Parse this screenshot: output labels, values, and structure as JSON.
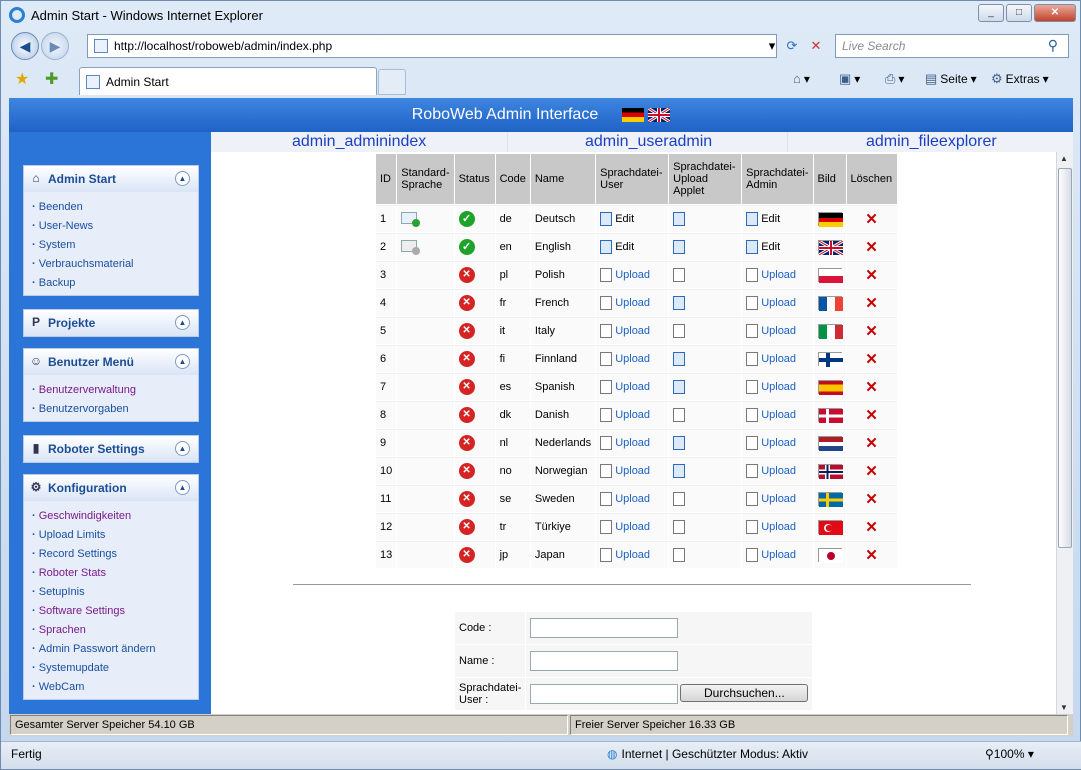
{
  "window": {
    "title": "Admin Start - Windows Internet Explorer"
  },
  "address": {
    "url": "http://localhost/roboweb/admin/index.php",
    "search_placeholder": "Live Search"
  },
  "tab": {
    "label": "Admin Start"
  },
  "commands": {
    "page": "Seite",
    "extras": "Extras"
  },
  "header": {
    "title": "RoboWeb Admin Interface"
  },
  "topnav": [
    "admin_adminindex",
    "admin_useradmin",
    "admin_fileexplorer"
  ],
  "sidebar": [
    {
      "title": "Admin Start",
      "items": [
        {
          "label": "Beenden",
          "v": false
        },
        {
          "label": "User-News",
          "v": false
        },
        {
          "label": "System",
          "v": false
        },
        {
          "label": "Verbrauchsmaterial",
          "v": false
        },
        {
          "label": "Backup",
          "v": false
        }
      ]
    },
    {
      "title": "Projekte",
      "items": []
    },
    {
      "title": "Benutzer Menü",
      "items": [
        {
          "label": "Benutzerverwaltung",
          "v": true
        },
        {
          "label": "Benutzervorgaben",
          "v": false
        }
      ]
    },
    {
      "title": "Roboter Settings",
      "items": []
    },
    {
      "title": "Konfiguration",
      "items": [
        {
          "label": "Geschwindigkeiten",
          "v": true
        },
        {
          "label": "Upload Limits",
          "v": false
        },
        {
          "label": "Record Settings",
          "v": false
        },
        {
          "label": "Roboter Stats",
          "v": true
        },
        {
          "label": "SetupInis",
          "v": false
        },
        {
          "label": "Software Settings",
          "v": true
        },
        {
          "label": "Sprachen",
          "v": true
        },
        {
          "label": "Admin Passwort ändern",
          "v": false
        },
        {
          "label": "Systemupdate",
          "v": false
        },
        {
          "label": "WebCam",
          "v": false
        }
      ]
    }
  ],
  "table": {
    "headers": [
      "ID",
      "Standard-Sprache",
      "Status",
      "Code",
      "Name",
      "Sprachdatei-User",
      "Sprachdatei-Upload Applet",
      "Sprachdatei-Admin",
      "Bild",
      "Löschen"
    ],
    "edit_label": "Edit",
    "upload_label": "Upload",
    "rows": [
      {
        "id": "1",
        "std": "active",
        "ok": true,
        "code": "de",
        "name": "Deutsch",
        "flag": "de"
      },
      {
        "id": "2",
        "std": "inactive",
        "ok": true,
        "code": "en",
        "name": "English",
        "flag": "gb"
      },
      {
        "id": "3",
        "std": "",
        "ok": false,
        "code": "pl",
        "name": "Polish",
        "flag": "pl"
      },
      {
        "id": "4",
        "std": "",
        "ok": false,
        "code": "fr",
        "name": "French",
        "flag": "fr"
      },
      {
        "id": "5",
        "std": "",
        "ok": false,
        "code": "it",
        "name": "Italy",
        "flag": "it"
      },
      {
        "id": "6",
        "std": "",
        "ok": false,
        "code": "fi",
        "name": "Finnland",
        "flag": "fi"
      },
      {
        "id": "7",
        "std": "",
        "ok": false,
        "code": "es",
        "name": "Spanish",
        "flag": "es"
      },
      {
        "id": "8",
        "std": "",
        "ok": false,
        "code": "dk",
        "name": "Danish",
        "flag": "dk"
      },
      {
        "id": "9",
        "std": "",
        "ok": false,
        "code": "nl",
        "name": "Nederlands",
        "flag": "nl"
      },
      {
        "id": "10",
        "std": "",
        "ok": false,
        "code": "no",
        "name": "Norwegian",
        "flag": "no"
      },
      {
        "id": "11",
        "std": "",
        "ok": false,
        "code": "se",
        "name": "Sweden",
        "flag": "se"
      },
      {
        "id": "12",
        "std": "",
        "ok": false,
        "code": "tr",
        "name": "Türkiye",
        "flag": "tr"
      },
      {
        "id": "13",
        "std": "",
        "ok": false,
        "code": "jp",
        "name": "Japan",
        "flag": "jp"
      }
    ]
  },
  "form": {
    "code_label": "Code :",
    "name_label": "Name :",
    "file_label": "Sprachdatei-User :",
    "browse": "Durchsuchen..."
  },
  "memory": {
    "total": "Gesamter Server Speicher 54.10 GB",
    "free": "Freier Server Speicher 16.33 GB"
  },
  "status": {
    "ready": "Fertig",
    "zone": "Internet | Geschützter Modus: Aktiv",
    "zoom": "100%"
  }
}
